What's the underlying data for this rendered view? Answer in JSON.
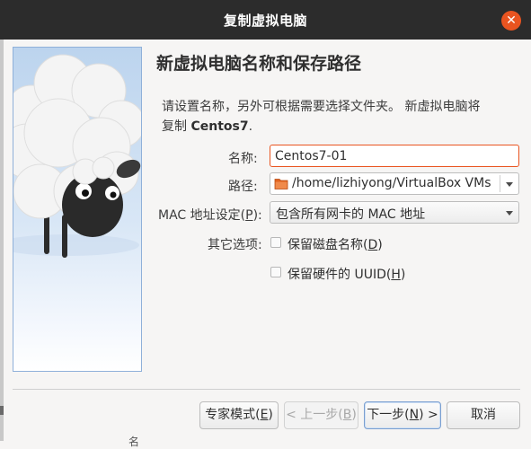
{
  "window": {
    "title": "复制虚拟电脑",
    "close_icon": "close-icon"
  },
  "page": {
    "heading": "新虚拟电脑名称和保存路径",
    "description_line1": "请设置名称，另外可根据需要选择文件夹。 新虚拟电脑将",
    "description_prefix": "复制 ",
    "description_vm": "Centos7",
    "description_suffix": "."
  },
  "form": {
    "name_label": "名称:",
    "name_value": "Centos7-01",
    "path_label": "路径:",
    "path_value": "/home/lizhiyong/VirtualBox VMs",
    "mac_label_prefix": "MAC 地址设定(",
    "mac_label_key": "P",
    "mac_label_suffix": "):",
    "mac_value": "包含所有网卡的 MAC 地址",
    "other_label": "其它选项:",
    "keep_disk_names_prefix": "保留磁盘名称(",
    "keep_disk_names_key": "D",
    "keep_disk_names_suffix": ")",
    "keep_disk_names_checked": false,
    "keep_hw_uuid_prefix": "保留硬件的 UUID(",
    "keep_hw_uuid_key": "H",
    "keep_hw_uuid_suffix": ")",
    "keep_hw_uuid_checked": false
  },
  "buttons": {
    "expert_prefix": "专家模式(",
    "expert_key": "E",
    "expert_suffix": ")",
    "back_prefix": "< 上一步(",
    "back_key": "B",
    "back_suffix": ")",
    "next_prefix": "下一步(",
    "next_key": "N",
    "next_suffix": ") >",
    "cancel": "取消"
  },
  "background": {
    "bottom_text": "名"
  },
  "colors": {
    "titlebar": "#2c2c2c",
    "accent": "#e95420",
    "focus_border": "#e95420",
    "watermark_border": "#8fb0d9"
  },
  "icons": {
    "folder": "folder-icon",
    "dropdown": "chevron-down-icon",
    "watermark": "sheep-illustration"
  }
}
